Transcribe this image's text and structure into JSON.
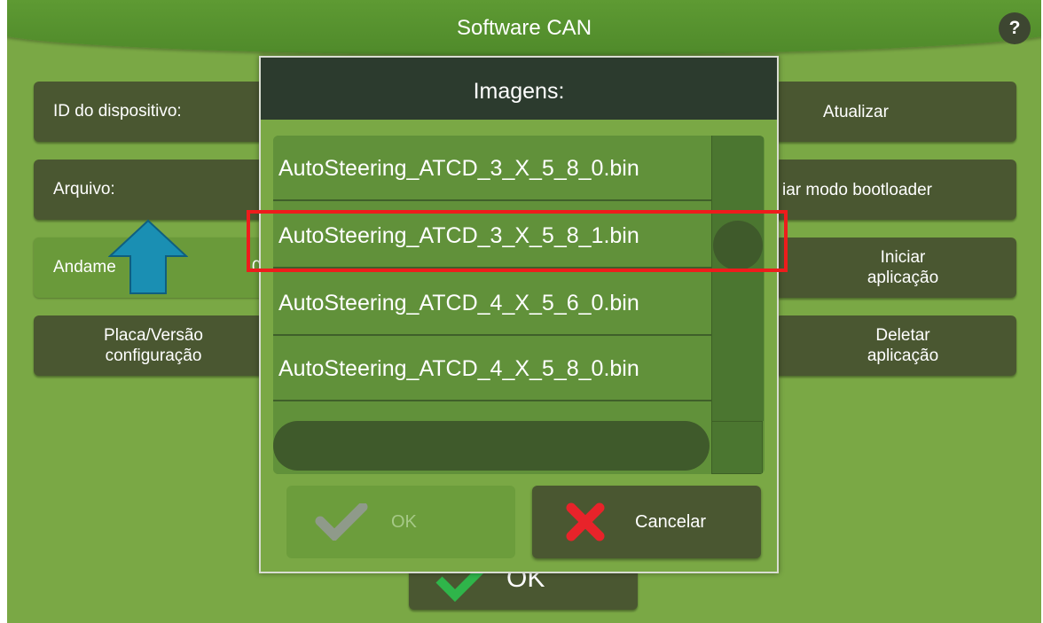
{
  "header": {
    "title": "Software CAN",
    "help_label": "?"
  },
  "main": {
    "device_id_label": "ID do dispositivo:",
    "file_label": "Arquivo:",
    "progress_label": "Andame",
    "progress_value": "0,",
    "board_version_line1": "Placa/Versão",
    "board_version_line2": "configuração",
    "update_label": "Atualizar",
    "bootloader_label": "iar modo bootloader",
    "start_app_line1": "Iniciar",
    "start_app_line2": "aplicação",
    "delete_app_line1": "Deletar",
    "delete_app_line2": "aplicação",
    "bottom_ok_label": "OK"
  },
  "dialog": {
    "title": "Imagens:",
    "items": [
      "AutoSteering_ATCD_3_X_5_8_0.bin",
      "AutoSteering_ATCD_3_X_5_8_1.bin",
      "AutoSteering_ATCD_4_X_5_6_0.bin",
      "AutoSteering_ATCD_4_X_5_8_0.bin"
    ],
    "ok_label": "OK",
    "cancel_label": "Cancelar"
  },
  "colors": {
    "background": "#7aa845",
    "button": "#4a5731",
    "dialog_header": "#2c3b2e",
    "highlight": "#ee1c1c",
    "arrow": "#1a8fb3"
  },
  "icons": [
    "help-icon",
    "up-arrow-icon",
    "check-icon",
    "cross-icon"
  ]
}
